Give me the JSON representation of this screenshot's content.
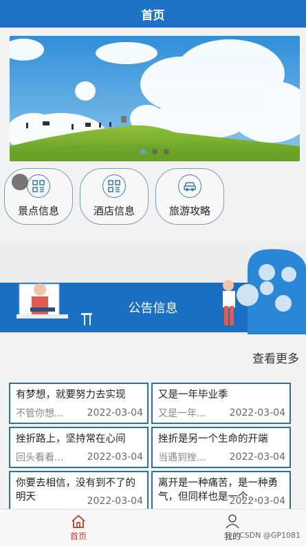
{
  "header": {
    "title": "首页"
  },
  "banner": {
    "dots": 3,
    "active_dot": 0
  },
  "quick_links": [
    {
      "label": "景点信息",
      "icon": "qr-grid-icon"
    },
    {
      "label": "酒店信息",
      "icon": "qr-grid-icon"
    },
    {
      "label": "旅游攻略",
      "icon": "car-icon"
    }
  ],
  "notice": {
    "title": "公告信息"
  },
  "more_label": "查看更多",
  "cards": [
    {
      "title": "有梦想，就要努力去实现",
      "summary": "不管你想...",
      "date": "2022-03-04"
    },
    {
      "title": "又是一年毕业季",
      "summary": "又是一年...",
      "date": "2022-03-04"
    },
    {
      "title": "挫折路上，坚持常在心间",
      "summary": "回头看看...",
      "date": "2022-03-04"
    },
    {
      "title": "挫折是另一个生命的开端",
      "summary": "当遇到挫...",
      "date": "2022-03-04"
    },
    {
      "title": "你要去相信，没有到不了的明天",
      "summary": "",
      "date": "2022-03-04"
    },
    {
      "title": "离开是一种痛苦，是一种勇气，但同样也是一个...",
      "summary": "",
      "date": "2022-03-04"
    }
  ],
  "tabbar": {
    "home": "首页",
    "mine": "我的"
  },
  "watermark": "CSDN @GP1081",
  "colors": {
    "primary": "#1f73c7",
    "active_tab": "#c0392b",
    "card_border": "#2f6f9f"
  }
}
